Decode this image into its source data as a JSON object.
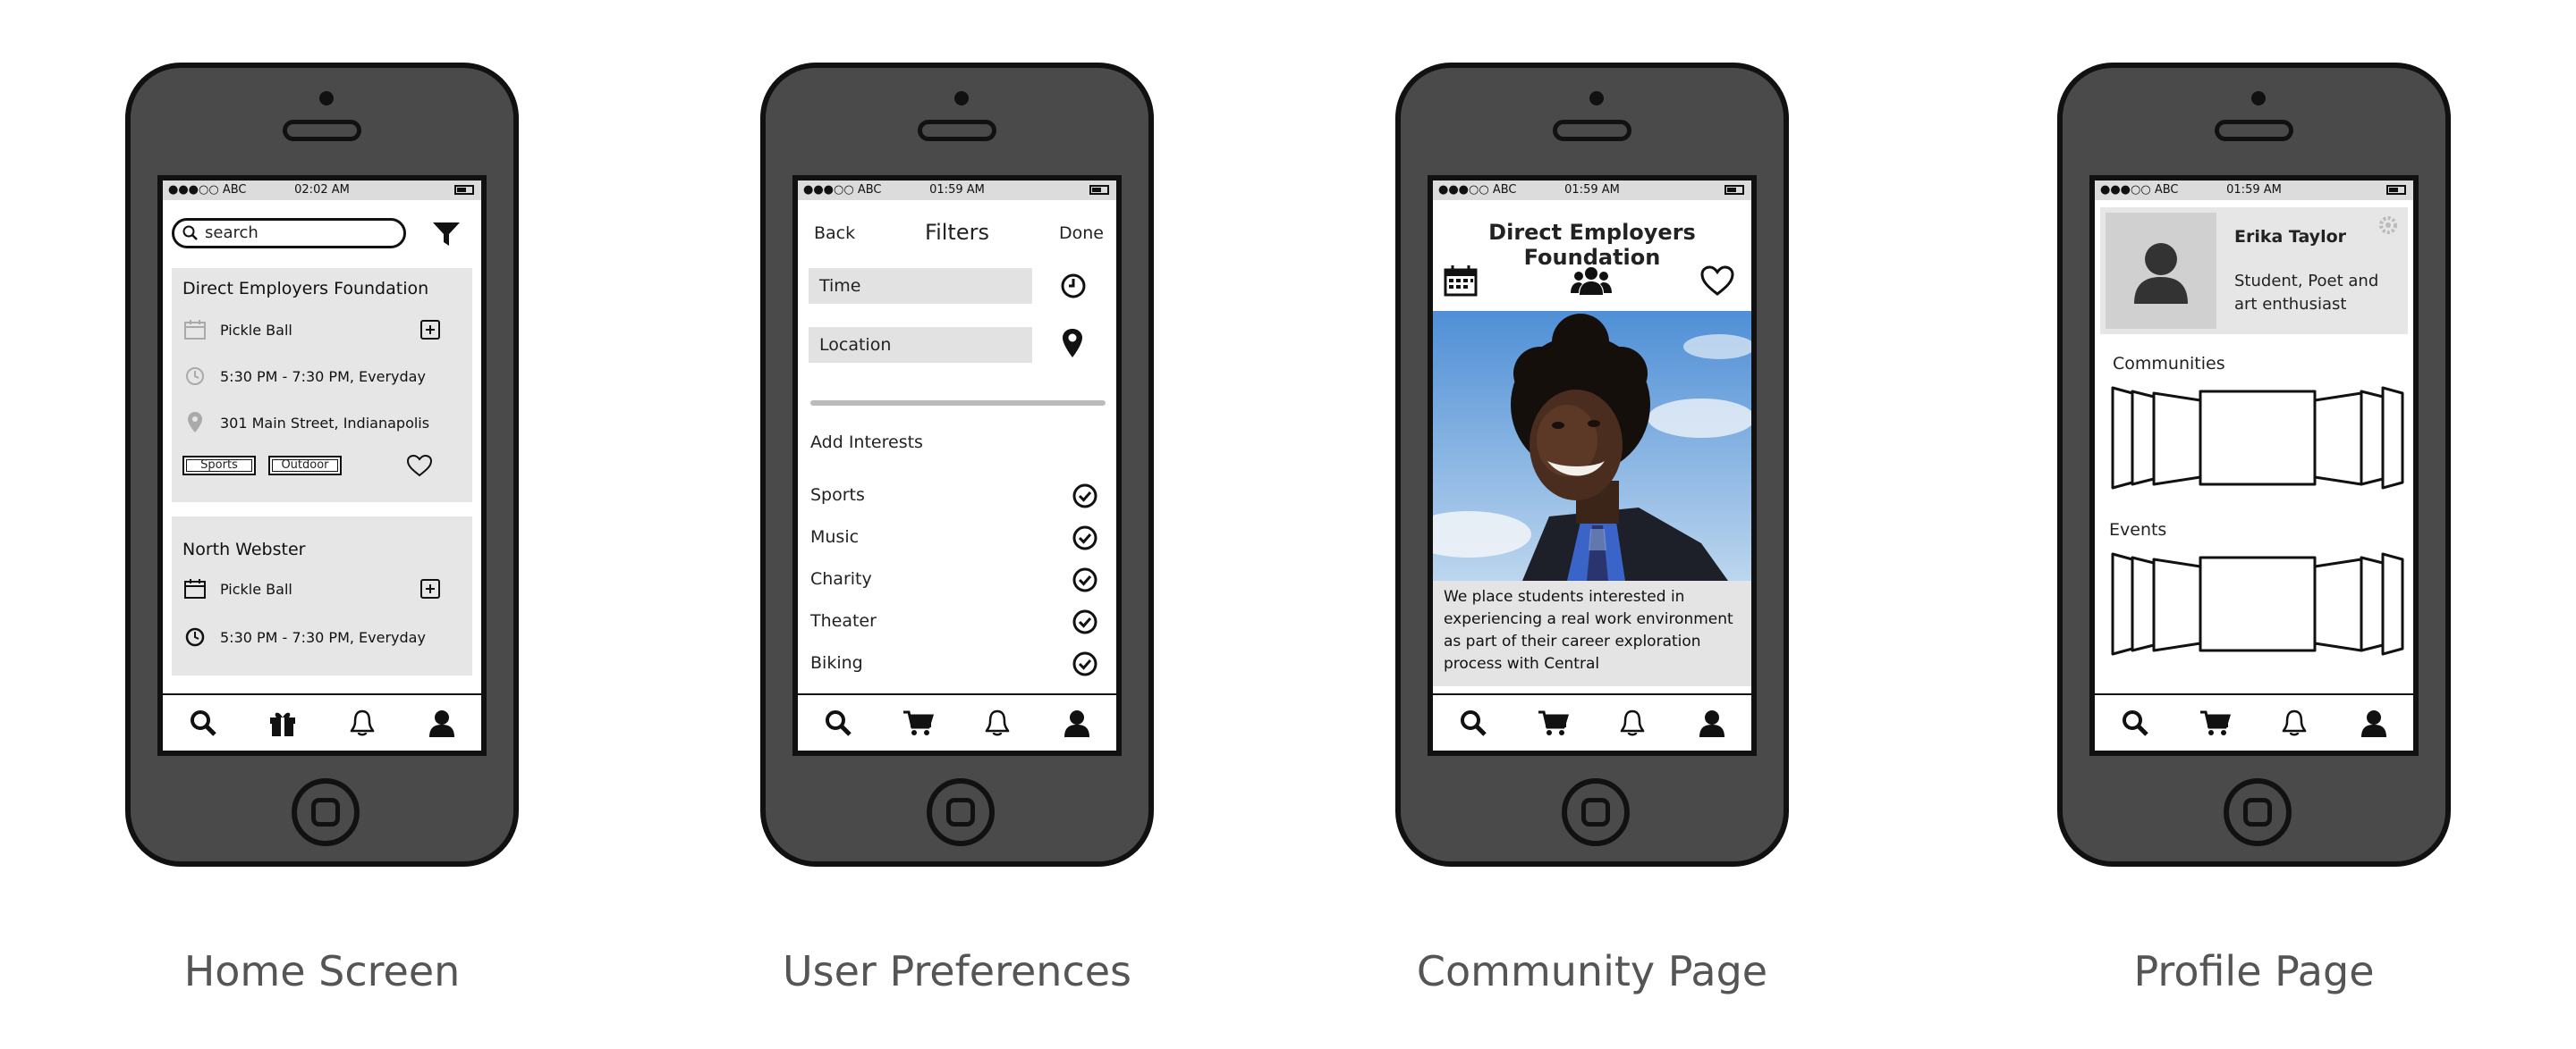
{
  "status": {
    "carrier": "●●●○○ ABC"
  },
  "screens": [
    {
      "label": "Home Screen",
      "time": "02:02 AM",
      "search_placeholder": "search",
      "cards": [
        {
          "title": "Direct Employers Foundation",
          "activity": "Pickle Ball",
          "time": "5:30 PM - 7:30 PM, Everyday",
          "address": "301 Main Street, Indianapolis",
          "tags": [
            "Sports",
            "Outdoor"
          ]
        },
        {
          "title": "North Webster",
          "activity": "Pickle Ball",
          "time": "5:30 PM - 7:30 PM, Everyday"
        }
      ]
    },
    {
      "label": "User Preferences",
      "time": "01:59 AM",
      "nav": {
        "back": "Back",
        "title": "Filters",
        "done": "Done"
      },
      "fields": [
        "Time",
        "Location"
      ],
      "section": "Add Interests",
      "interests": [
        "Sports",
        "Music",
        "Charity",
        "Theater",
        "Biking"
      ]
    },
    {
      "label": "Community Page",
      "time": "01:59 AM",
      "title": "Direct Employers Foundation",
      "description": "We place students interested in experiencing a real work environment as part of their career exploration process with Central"
    },
    {
      "label": "Profile Page",
      "time": "01:59 AM",
      "name": "Erika Taylor",
      "bio": "Student, Poet and art enthusiast",
      "sections": [
        "Communities",
        "Events"
      ]
    }
  ],
  "icons": {
    "home_tabs": [
      "search-icon",
      "gift-icon",
      "bell-icon",
      "user-icon"
    ],
    "other_tabs": [
      "search-icon",
      "cart-icon",
      "bell-icon",
      "user-icon"
    ]
  }
}
